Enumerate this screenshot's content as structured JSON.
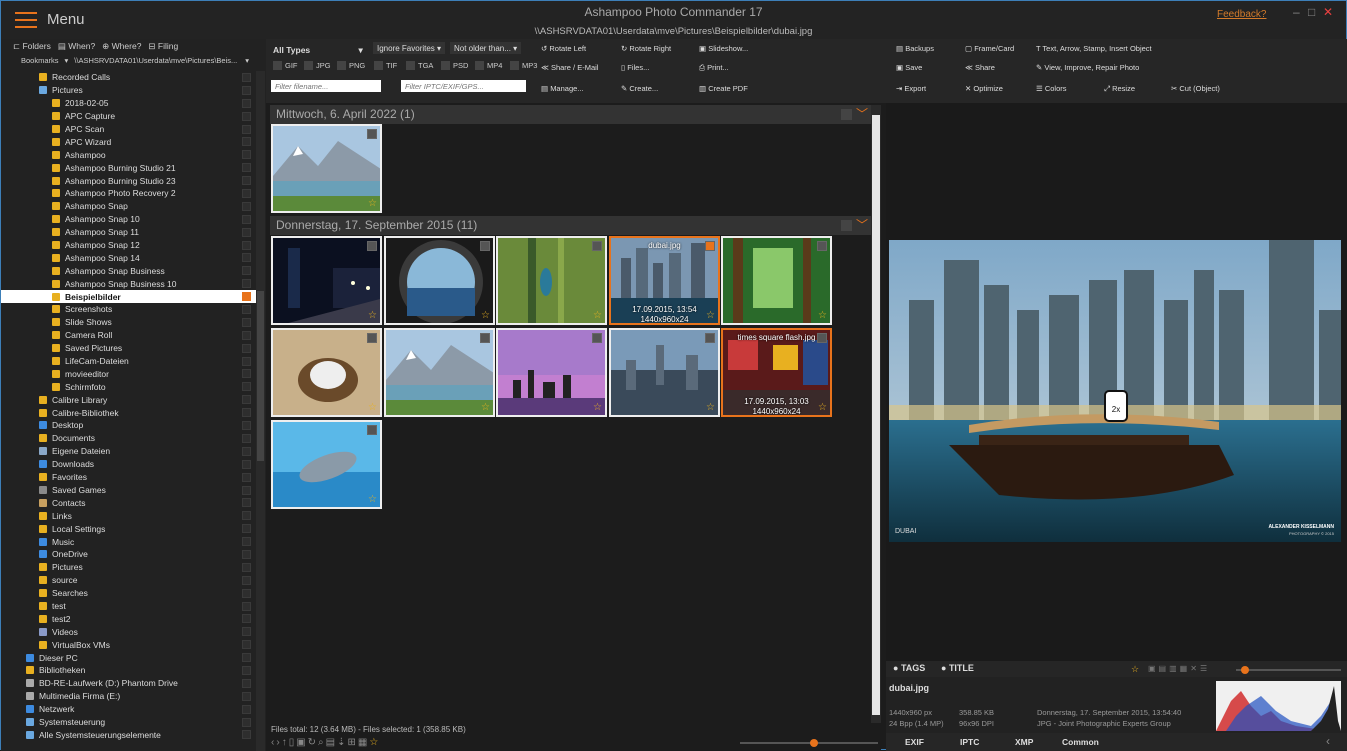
{
  "window": {
    "menu_label": "Menu",
    "app_title": "Ashampoo Photo Commander 17",
    "path": "\\\\ASHSRVDATA01\\Userdata\\mve\\Pictures\\Beispielbilder\\dubai.jpg",
    "feedback": "Feedback?",
    "minimize": "–",
    "maximize": "□",
    "close": "✕"
  },
  "nav_tabs": [
    "Folders",
    "When?",
    "Where?",
    "Filing"
  ],
  "bookmarks": {
    "label": "Bookmarks",
    "path": "\\\\ASHSRVDATA01\\Userdata\\mve\\Pictures\\Beis..."
  },
  "tree": [
    {
      "label": "Recorded Calls",
      "indent": 2,
      "icon": "folder"
    },
    {
      "label": "Pictures",
      "indent": 2,
      "icon": "pictures"
    },
    {
      "label": "2018-02-05",
      "indent": 3,
      "icon": "folder"
    },
    {
      "label": "APC Capture",
      "indent": 3,
      "icon": "folder"
    },
    {
      "label": "APC Scan",
      "indent": 3,
      "icon": "folder"
    },
    {
      "label": "APC Wizard",
      "indent": 3,
      "icon": "folder"
    },
    {
      "label": "Ashampoo",
      "indent": 3,
      "icon": "folder"
    },
    {
      "label": "Ashampoo Burning Studio 21",
      "indent": 3,
      "icon": "folder"
    },
    {
      "label": "Ashampoo Burning Studio 23",
      "indent": 3,
      "icon": "folder"
    },
    {
      "label": "Ashampoo Photo Recovery 2",
      "indent": 3,
      "icon": "folder"
    },
    {
      "label": "Ashampoo Snap",
      "indent": 3,
      "icon": "folder"
    },
    {
      "label": "Ashampoo Snap 10",
      "indent": 3,
      "icon": "folder"
    },
    {
      "label": "Ashampoo Snap 11",
      "indent": 3,
      "icon": "folder"
    },
    {
      "label": "Ashampoo Snap 12",
      "indent": 3,
      "icon": "folder"
    },
    {
      "label": "Ashampoo Snap 14",
      "indent": 3,
      "icon": "folder"
    },
    {
      "label": "Ashampoo Snap Business",
      "indent": 3,
      "icon": "folder"
    },
    {
      "label": "Ashampoo Snap Business 10",
      "indent": 3,
      "icon": "folder"
    },
    {
      "label": "Beispielbilder",
      "indent": 3,
      "icon": "folder",
      "selected": true,
      "checked": true
    },
    {
      "label": "Screenshots",
      "indent": 3,
      "icon": "folder"
    },
    {
      "label": "Slide Shows",
      "indent": 3,
      "icon": "folder"
    },
    {
      "label": "Camera Roll",
      "indent": 3,
      "icon": "folder"
    },
    {
      "label": "Saved Pictures",
      "indent": 3,
      "icon": "folder"
    },
    {
      "label": "LifeCam-Dateien",
      "indent": 3,
      "icon": "folder"
    },
    {
      "label": "movieeditor",
      "indent": 3,
      "icon": "folder"
    },
    {
      "label": "Schirmfoto",
      "indent": 3,
      "icon": "folder"
    },
    {
      "label": "Calibre Library",
      "indent": 2,
      "icon": "folder"
    },
    {
      "label": "Calibre-Bibliothek",
      "indent": 2,
      "icon": "folder"
    },
    {
      "label": "Desktop",
      "indent": 2,
      "icon": "desktop"
    },
    {
      "label": "Documents",
      "indent": 2,
      "icon": "folder"
    },
    {
      "label": "Eigene Dateien",
      "indent": 2,
      "icon": "docs"
    },
    {
      "label": "Downloads",
      "indent": 2,
      "icon": "download"
    },
    {
      "label": "Favorites",
      "indent": 2,
      "icon": "folder"
    },
    {
      "label": "Saved Games",
      "indent": 2,
      "icon": "games"
    },
    {
      "label": "Contacts",
      "indent": 2,
      "icon": "contacts"
    },
    {
      "label": "Links",
      "indent": 2,
      "icon": "links"
    },
    {
      "label": "Local Settings",
      "indent": 2,
      "icon": "folder"
    },
    {
      "label": "Music",
      "indent": 2,
      "icon": "music"
    },
    {
      "label": "OneDrive",
      "indent": 2,
      "icon": "onedrive"
    },
    {
      "label": "Pictures",
      "indent": 2,
      "icon": "folder"
    },
    {
      "label": "source",
      "indent": 2,
      "icon": "folder"
    },
    {
      "label": "Searches",
      "indent": 2,
      "icon": "search"
    },
    {
      "label": "test",
      "indent": 2,
      "icon": "folder"
    },
    {
      "label": "test2",
      "indent": 2,
      "icon": "folder"
    },
    {
      "label": "Videos",
      "indent": 2,
      "icon": "video"
    },
    {
      "label": "VirtualBox VMs",
      "indent": 2,
      "icon": "folder"
    },
    {
      "label": "Dieser PC",
      "indent": 1,
      "icon": "pc"
    },
    {
      "label": "Bibliotheken",
      "indent": 1,
      "icon": "library"
    },
    {
      "label": "BD-RE-Laufwerk (D:) Phantom Drive",
      "indent": 1,
      "icon": "drive"
    },
    {
      "label": "Multimedia Firma (E:)",
      "indent": 1,
      "icon": "netdrive"
    },
    {
      "label": "Netzwerk",
      "indent": 1,
      "icon": "network"
    },
    {
      "label": "Systemsteuerung",
      "indent": 1,
      "icon": "control"
    },
    {
      "label": "Alle Systemsteuerungselemente",
      "indent": 1,
      "icon": "control"
    }
  ],
  "filters": {
    "type": "All Types",
    "favorites": "Ignore Favorites",
    "age": "Not older than...",
    "formats": [
      "GIF",
      "JPG",
      "PNG",
      "TIF",
      "TGA",
      "PSD",
      "MP4",
      "MP3"
    ],
    "filename_placeholder": "Filter filename...",
    "meta_placeholder": "Filter IPTC/EXIF/GPS..."
  },
  "actions": {
    "rotate_left": "Rotate Left",
    "rotate_right": "Rotate Right",
    "slideshow": "Slideshow...",
    "share_email": "Share / E-Mail",
    "files": "Files...",
    "print": "Print...",
    "manage": "Manage...",
    "create": "Create...",
    "create_pdf": "Create PDF",
    "backups": "Backups",
    "frame_card": "Frame/Card",
    "text_arrow": "Text, Arrow, Stamp, Insert Object",
    "save": "Save",
    "share": "Share",
    "view_improve": "View, Improve, Repair Photo",
    "export": "Export",
    "optimize": "Optimize",
    "colors": "Colors",
    "resize": "Resize",
    "cut": "Cut (Object)"
  },
  "groups": [
    {
      "title": "Mittwoch, 6. April 2022 (1)"
    },
    {
      "title": "Donnerstag, 17. September 2015 (11)"
    }
  ],
  "thumbs": [
    {
      "theme": "lake",
      "checked": false
    },
    {
      "theme": "night",
      "checked": false
    },
    {
      "theme": "porthole",
      "checked": false
    },
    {
      "theme": "bug",
      "checked": false
    },
    {
      "theme": "city",
      "checked": true,
      "name": "dubai.jpg",
      "date": "17.09.2015, 13:54",
      "size": "1440x960x24"
    },
    {
      "theme": "forest",
      "checked": false
    },
    {
      "theme": "goat",
      "checked": false
    },
    {
      "theme": "lake",
      "checked": false
    },
    {
      "theme": "skyline",
      "checked": false
    },
    {
      "theme": "nyc",
      "checked": false
    },
    {
      "theme": "times",
      "checked": false,
      "name": "times square flash.jpg",
      "date": "17.09.2015, 13:03",
      "size": "1440x960x24"
    },
    {
      "theme": "dolphin",
      "checked": false
    }
  ],
  "status": {
    "text": "Files total: 12 (3.64 MB) - Files selected: 1 (358.85 KB)"
  },
  "preview": {
    "caption": "DUBAI",
    "credit": "ALEXANDER KISSELMANN",
    "credit_sub": "PHOTOGRAPHY © 2015",
    "zoom_hint": "2x",
    "tag_tabs": [
      "TAGS",
      "TITLE"
    ],
    "filename": "dubai.jpg",
    "dims": "1440x960 px",
    "bpp": "24 Bpp (1.4 MP)",
    "filesize": "358.85 KB",
    "dpi": "96x96 DPI",
    "date": "Donnerstag, 17. September 2015, 13:54:40",
    "format": "JPG - Joint Photographic Experts Group",
    "info_tabs": [
      "EXIF",
      "IPTC",
      "XMP",
      "Common"
    ]
  },
  "colors": {
    "accent": "#e8731c",
    "folder": "#e8b020",
    "star": "#e8b020",
    "link": "#d47b2a"
  }
}
